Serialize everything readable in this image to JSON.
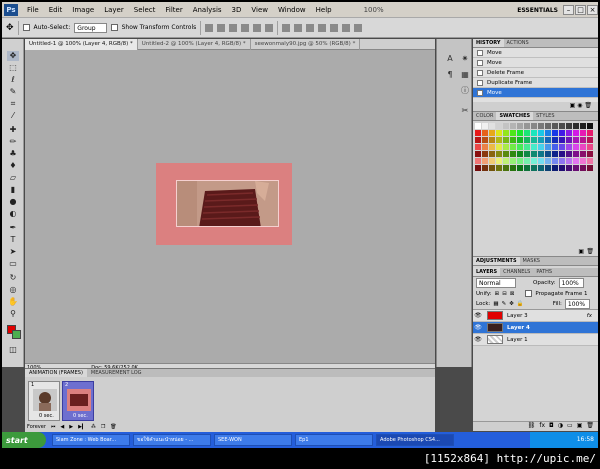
{
  "menubar": {
    "logo": "Ps",
    "items": [
      "File",
      "Edit",
      "Image",
      "Layer",
      "Select",
      "Filter",
      "Analysis",
      "3D",
      "View",
      "Window",
      "Help"
    ],
    "zoom": "100%",
    "workspace": "ESSENTIALS"
  },
  "options": {
    "auto_select_label": "Auto-Select:",
    "auto_select_value": "Group",
    "transform_label": "Show Transform Controls"
  },
  "document": {
    "tabs": [
      "Untitled-1 @ 100% (Layer 4, RGB/8) *",
      "Untitled-2 @ 100% (Layer 4, RGB/8) *",
      "seewonmaly90.jpg @ 50% (RGB/8) *"
    ],
    "zoom_status": "100%",
    "doc_status": "Doc: 59.6K/252.0K"
  },
  "animation": {
    "tabs": [
      "ANIMATION (FRAMES)",
      "MEASUREMENT LOG"
    ],
    "frames": [
      {
        "num": "1",
        "delay": "0 sec."
      },
      {
        "num": "2",
        "delay": "0 sec."
      }
    ],
    "loop": "Forever"
  },
  "history": {
    "tabs": [
      "HISTORY",
      "ACTIONS"
    ],
    "items": [
      "Move",
      "Move",
      "Delete Frame",
      "Duplicate Frame",
      "Move"
    ]
  },
  "color": {
    "tabs": [
      "COLOR",
      "SWATCHES",
      "STYLES"
    ]
  },
  "adjust": {
    "tabs": [
      "ADJUSTMENTS",
      "MASKS"
    ]
  },
  "layers": {
    "tabs": [
      "LAYERS",
      "CHANNELS",
      "PATHS"
    ],
    "blend_mode": "Normal",
    "opacity_label": "Opacity:",
    "opacity_value": "100%",
    "unify_label": "Unify:",
    "propagate_label": "Propagate Frame 1",
    "lock_label": "Lock:",
    "fill_label": "Fill:",
    "fill_value": "100%",
    "items": [
      "Layer 3",
      "Layer 4",
      "Layer 1"
    ]
  },
  "taskbar": {
    "start": "start",
    "tasks": [
      "Siam Zone : Web Boar...",
      "ขอใช้คำแนะนำหน่อย - ...",
      "SEE-WON",
      "Ep1",
      "Adobe Photoshop CS4..."
    ],
    "clock": "16:58"
  },
  "caption": "[1152x864] http://upic.me/"
}
